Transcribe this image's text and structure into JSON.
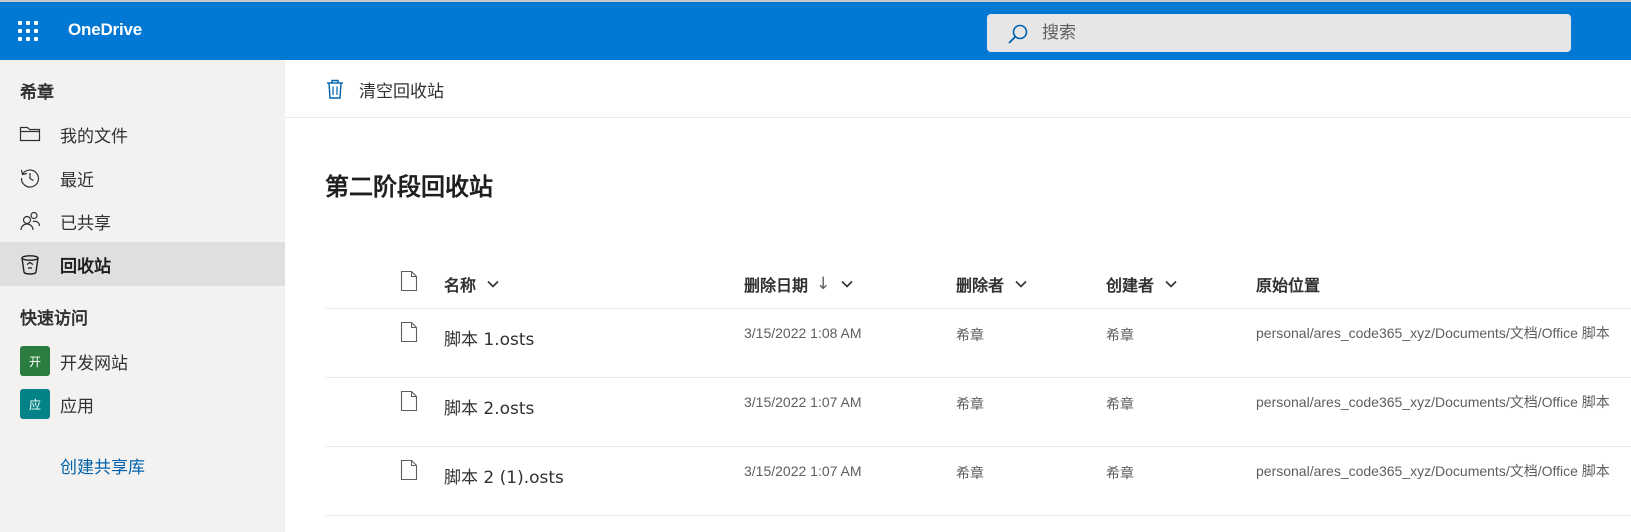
{
  "header": {
    "brand": "OneDrive",
    "search_placeholder": "搜索"
  },
  "sidebar": {
    "user": "希章",
    "nav": [
      {
        "label": "我的文件",
        "icon": "folder-icon"
      },
      {
        "label": "最近",
        "icon": "history-icon"
      },
      {
        "label": "已共享",
        "icon": "people-icon"
      },
      {
        "label": "回收站",
        "icon": "recycle-bin-icon",
        "active": true
      }
    ],
    "quick_access_title": "快速访问",
    "quick_access": [
      {
        "label": "开发网站",
        "badge": "开",
        "color": "#2b7d3f"
      },
      {
        "label": "应用",
        "badge": "应",
        "color": "#038387"
      }
    ],
    "create_library": "创建共享库"
  },
  "commandbar": {
    "empty_bin": "清空回收站"
  },
  "page": {
    "title": "第二阶段回收站"
  },
  "table": {
    "columns": {
      "name": "名称",
      "deleted_date": "删除日期",
      "sort_arrow": "↓",
      "deleted_by": "删除者",
      "created_by": "创建者",
      "original_location": "原始位置"
    },
    "rows": [
      {
        "name": "脚本 1.osts",
        "deleted_date": "3/15/2022 1:08 AM",
        "deleted_by": "希章",
        "created_by": "希章",
        "location": "personal/ares_code365_xyz/Documents/文档/Office 脚本"
      },
      {
        "name": "脚本 2.osts",
        "deleted_date": "3/15/2022 1:07 AM",
        "deleted_by": "希章",
        "created_by": "希章",
        "location": "personal/ares_code365_xyz/Documents/文档/Office 脚本"
      },
      {
        "name": "脚本 2 (1).osts",
        "deleted_date": "3/15/2022 1:07 AM",
        "deleted_by": "希章",
        "created_by": "希章",
        "location": "personal/ares_code365_xyz/Documents/文档/Office 脚本"
      }
    ]
  },
  "colors": {
    "header_bg": "#0078d4",
    "sidebar_bg": "#f3f2f1",
    "active_bg": "#e1dfdd",
    "link": "#0062ad"
  }
}
